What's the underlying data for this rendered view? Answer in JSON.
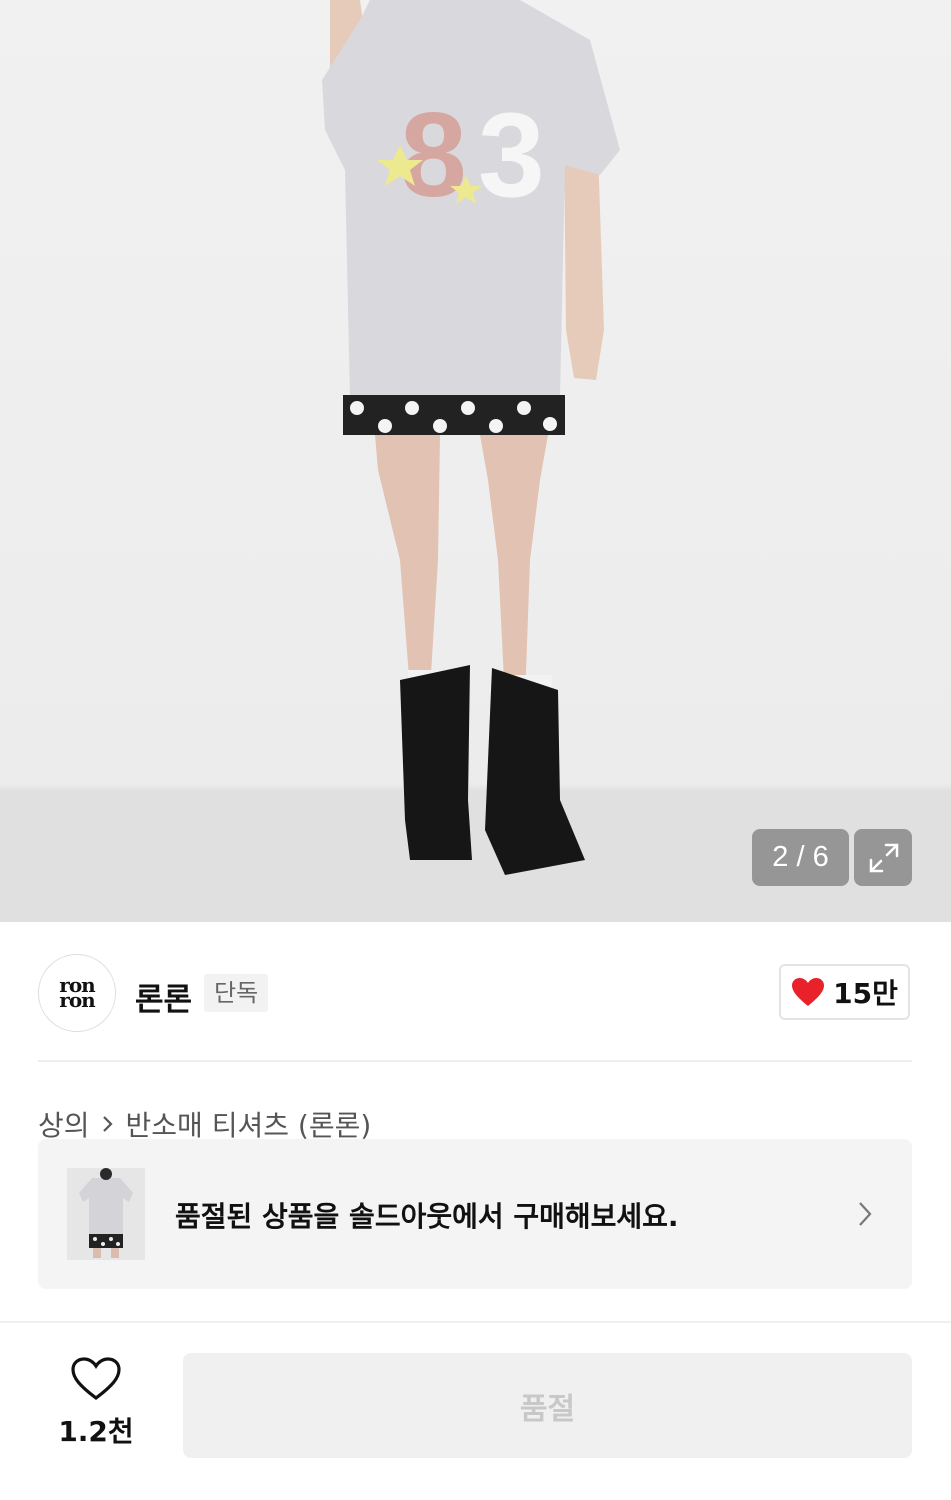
{
  "gallery": {
    "counter": "2 / 6",
    "expand_icon": "expand-icon"
  },
  "shop": {
    "logo_text": [
      "ron",
      "ron"
    ],
    "name": "론론",
    "badge": "단독",
    "likes": "15만",
    "like_icon": "heart-filled-icon",
    "heart_color": "#e8212b"
  },
  "breadcrumb": {
    "category": "상의",
    "sub_category": "반소매 티셔츠 (론론)"
  },
  "banner": {
    "message": "품절된 상품을 솔드아웃에서 구매해보세요."
  },
  "bottom_bar": {
    "wish_count": "1.2천",
    "buy_button_label": "품절"
  }
}
